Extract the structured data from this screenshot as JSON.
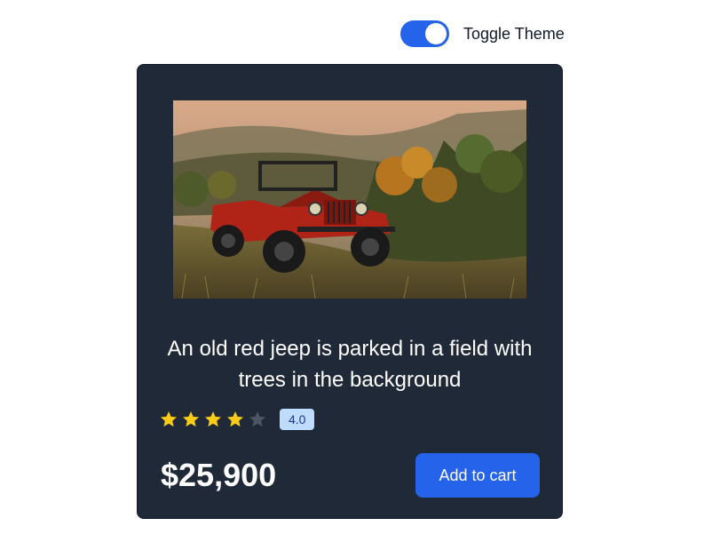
{
  "theme_toggle": {
    "label": "Toggle Theme",
    "state": "on",
    "accent_color": "#2563eb"
  },
  "product": {
    "image_icon": "red-jeep-photo",
    "title": "An old red jeep is parked in a field with trees in the background",
    "rating": 4.0,
    "rating_label": "4.0",
    "max_rating": 5,
    "price": "$25,900",
    "add_to_cart_label": "Add to cart",
    "card_color": "#1f2937",
    "star_color": "#facc15",
    "star_empty_color": "#4b5563"
  }
}
